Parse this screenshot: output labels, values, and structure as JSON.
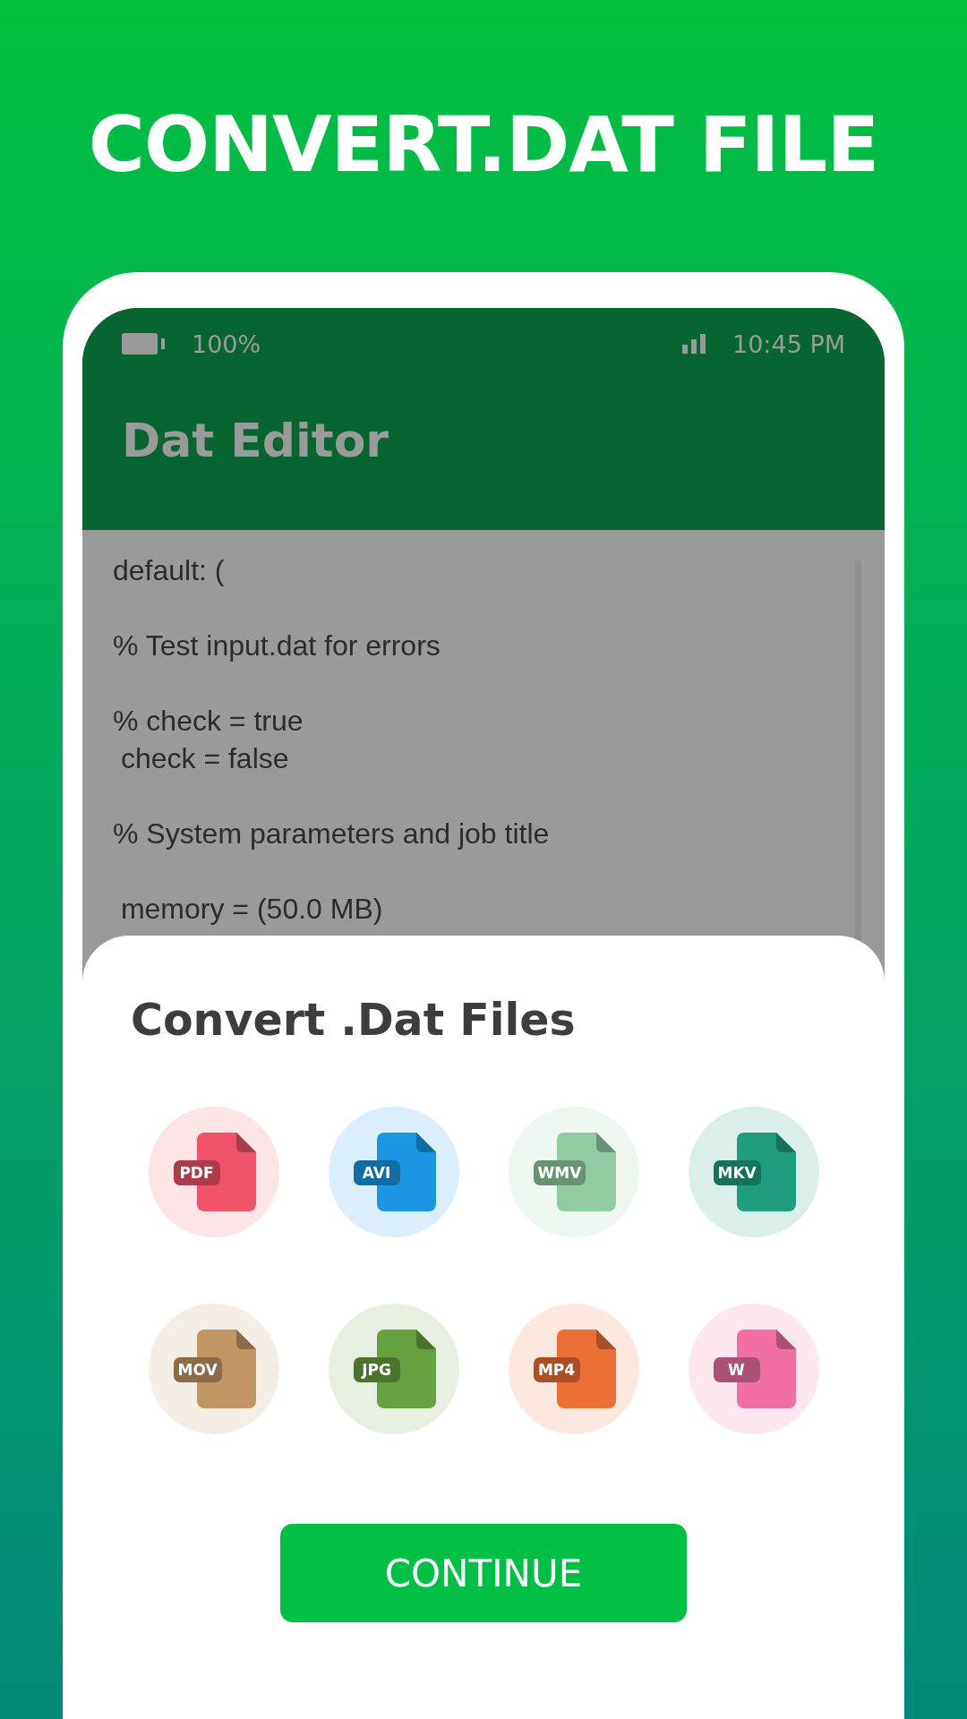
{
  "headline": "CONVERT.DAT FILE",
  "status_bar": {
    "battery": "100%",
    "time": "10:45 PM"
  },
  "app_bar": {
    "title": "Dat Editor"
  },
  "editor": {
    "blocks": [
      [
        "default: ("
      ],
      [
        "% Test input.dat for errors"
      ],
      [
        "% check = true",
        " check = false"
      ],
      [
        "% System parameters and job title"
      ],
      [
        " memory = (50.0 MB)"
      ]
    ]
  },
  "sheet": {
    "title": "Convert .Dat Files",
    "formats": [
      {
        "label": "PDF",
        "color": "#f05468"
      },
      {
        "label": "AVI",
        "color": "#1a96e3"
      },
      {
        "label": "WMV",
        "color": "#92cba1"
      },
      {
        "label": "MKV",
        "color": "#1f9e7e"
      },
      {
        "label": "MOV",
        "color": "#c29565"
      },
      {
        "label": "JPG",
        "color": "#67a03e"
      },
      {
        "label": "MP4",
        "color": "#ec6f36"
      },
      {
        "label": "W",
        "color": "#f06fa2"
      }
    ],
    "button": "CONTINUE"
  }
}
